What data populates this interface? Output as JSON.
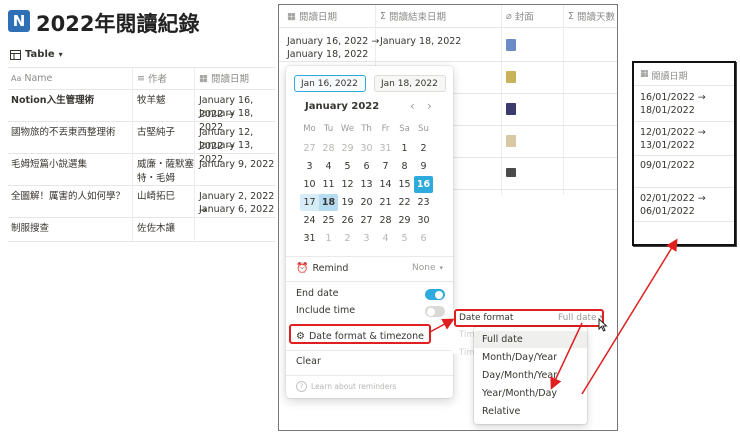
{
  "page": {
    "title_icon": "N",
    "title": "2022年閱讀紀錄",
    "view_label": "Table",
    "columns": [
      "Name",
      "作者",
      "閱讀日期"
    ],
    "rows": [
      {
        "name": "Notion入生管理術",
        "author": "牧羊魃",
        "date_1": "January 16, 2022 →",
        "date_2": "January 18, 2022"
      },
      {
        "name": "國物旅的不丟東西整理術",
        "author": "古堅純子",
        "date_1": "January 12, 2022 →",
        "date_2": "January 13, 2022"
      },
      {
        "name": "毛姆短篇小說選集",
        "author": "威廉・薩默塞特・毛姆",
        "date_1": "January 9, 2022",
        "date_2": ""
      },
      {
        "name": "全圖解！厲害的人如何學？",
        "author": "山崎拓巳",
        "date_1": "January 2, 2022 →",
        "date_2": "January 6, 2022"
      },
      {
        "name": "制服搜查",
        "author": "佐佐木讓",
        "date_1": "",
        "date_2": ""
      }
    ]
  },
  "panel": {
    "columns": [
      "閱讀日期",
      "閱讀結束日期",
      "封面",
      "閱讀天數"
    ],
    "first_row_date_1": "January 16, 2022 →",
    "first_row_date_2": "January 18, 2022",
    "first_row_end": "January 18, 2022",
    "cover_colors": [
      "#6b8cc4",
      "#c9b35a",
      "#3a3a6e",
      "#d7c9a4",
      "#4a4a4a"
    ]
  },
  "datepicker": {
    "start_value": "Jan 16, 2022",
    "end_value": "Jan 18, 2022",
    "month_label": "January 2022",
    "prev": "‹",
    "next": "›",
    "weekdays": [
      "Mo",
      "Tu",
      "We",
      "Th",
      "Fr",
      "Sa",
      "Su"
    ],
    "weeks": [
      [
        "27",
        "28",
        "29",
        "30",
        "31",
        "1",
        "2"
      ],
      [
        "3",
        "4",
        "5",
        "6",
        "7",
        "8",
        "9"
      ],
      [
        "10",
        "11",
        "12",
        "13",
        "14",
        "15",
        "16"
      ],
      [
        "17",
        "18",
        "19",
        "20",
        "21",
        "22",
        "23"
      ],
      [
        "24",
        "25",
        "26",
        "27",
        "28",
        "29",
        "30"
      ],
      [
        "31",
        "1",
        "2",
        "3",
        "4",
        "5",
        "6"
      ]
    ],
    "remind_label": "Remind",
    "remind_value": "None",
    "end_date_label": "End date",
    "end_date_on": true,
    "include_time_label": "Include time",
    "include_time_on": false,
    "format_label": "Date format & timezone",
    "clear_label": "Clear",
    "help_label": "Learn about reminders",
    "accent": "#2eaadc"
  },
  "format_menu": {
    "label": "Date format",
    "value": "Full date",
    "ghost_1": "Tim",
    "ghost_2": "Tim",
    "options": [
      "Full date",
      "Month/Day/Year",
      "Day/Month/Year",
      "Year/Month/Day",
      "Relative"
    ]
  },
  "result": {
    "column": "閱讀日期",
    "entries": [
      {
        "line_1": "16/01/2022 →",
        "line_2": "18/01/2022"
      },
      {
        "line_1": "12/01/2022 →",
        "line_2": "13/01/2022"
      },
      {
        "line_1": "09/01/2022",
        "line_2": ""
      },
      {
        "line_1": "02/01/2022 →",
        "line_2": "06/01/2022"
      }
    ]
  },
  "annotation_color": "#e02020"
}
